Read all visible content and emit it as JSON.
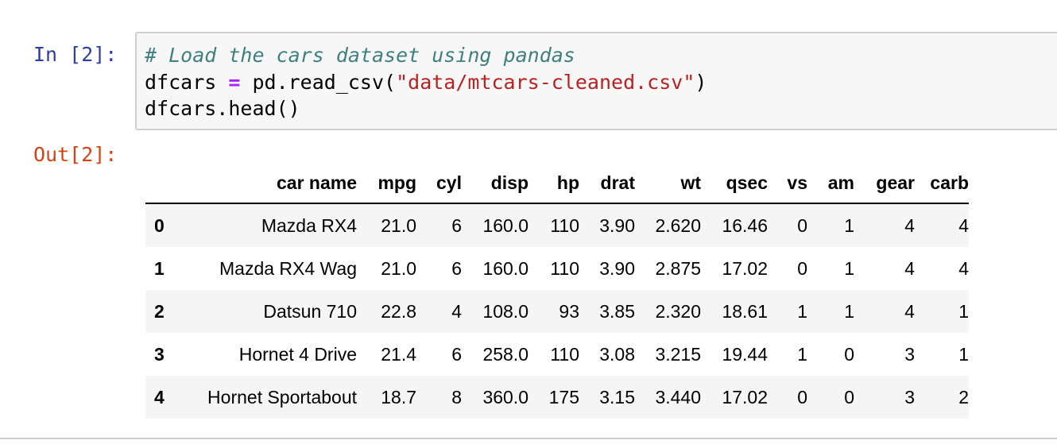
{
  "input_cell": {
    "prompt": "In [2]:",
    "code": {
      "comment": "# Load the cars dataset using pandas",
      "line2_var": "dfcars ",
      "line2_op": "=",
      "line2_call": " pd.read_csv(",
      "line2_str": "\"data/mtcars-cleaned.csv\"",
      "line2_end": ")",
      "line3": "dfcars.head()"
    }
  },
  "output_cell": {
    "prompt": "Out[2]:",
    "table": {
      "columns": [
        "",
        "car name",
        "mpg",
        "cyl",
        "disp",
        "hp",
        "drat",
        "wt",
        "qsec",
        "vs",
        "am",
        "gear",
        "carb"
      ],
      "rows": [
        [
          "0",
          "Mazda RX4",
          "21.0",
          "6",
          "160.0",
          "110",
          "3.90",
          "2.620",
          "16.46",
          "0",
          "1",
          "4",
          "4"
        ],
        [
          "1",
          "Mazda RX4 Wag",
          "21.0",
          "6",
          "160.0",
          "110",
          "3.90",
          "2.875",
          "17.02",
          "0",
          "1",
          "4",
          "4"
        ],
        [
          "2",
          "Datsun 710",
          "22.8",
          "4",
          "108.0",
          "93",
          "3.85",
          "2.320",
          "18.61",
          "1",
          "1",
          "4",
          "1"
        ],
        [
          "3",
          "Hornet 4 Drive",
          "21.4",
          "6",
          "258.0",
          "110",
          "3.08",
          "3.215",
          "19.44",
          "1",
          "0",
          "3",
          "1"
        ],
        [
          "4",
          "Hornet Sportabout",
          "18.7",
          "8",
          "360.0",
          "175",
          "3.15",
          "3.440",
          "17.02",
          "0",
          "0",
          "3",
          "2"
        ]
      ]
    }
  }
}
